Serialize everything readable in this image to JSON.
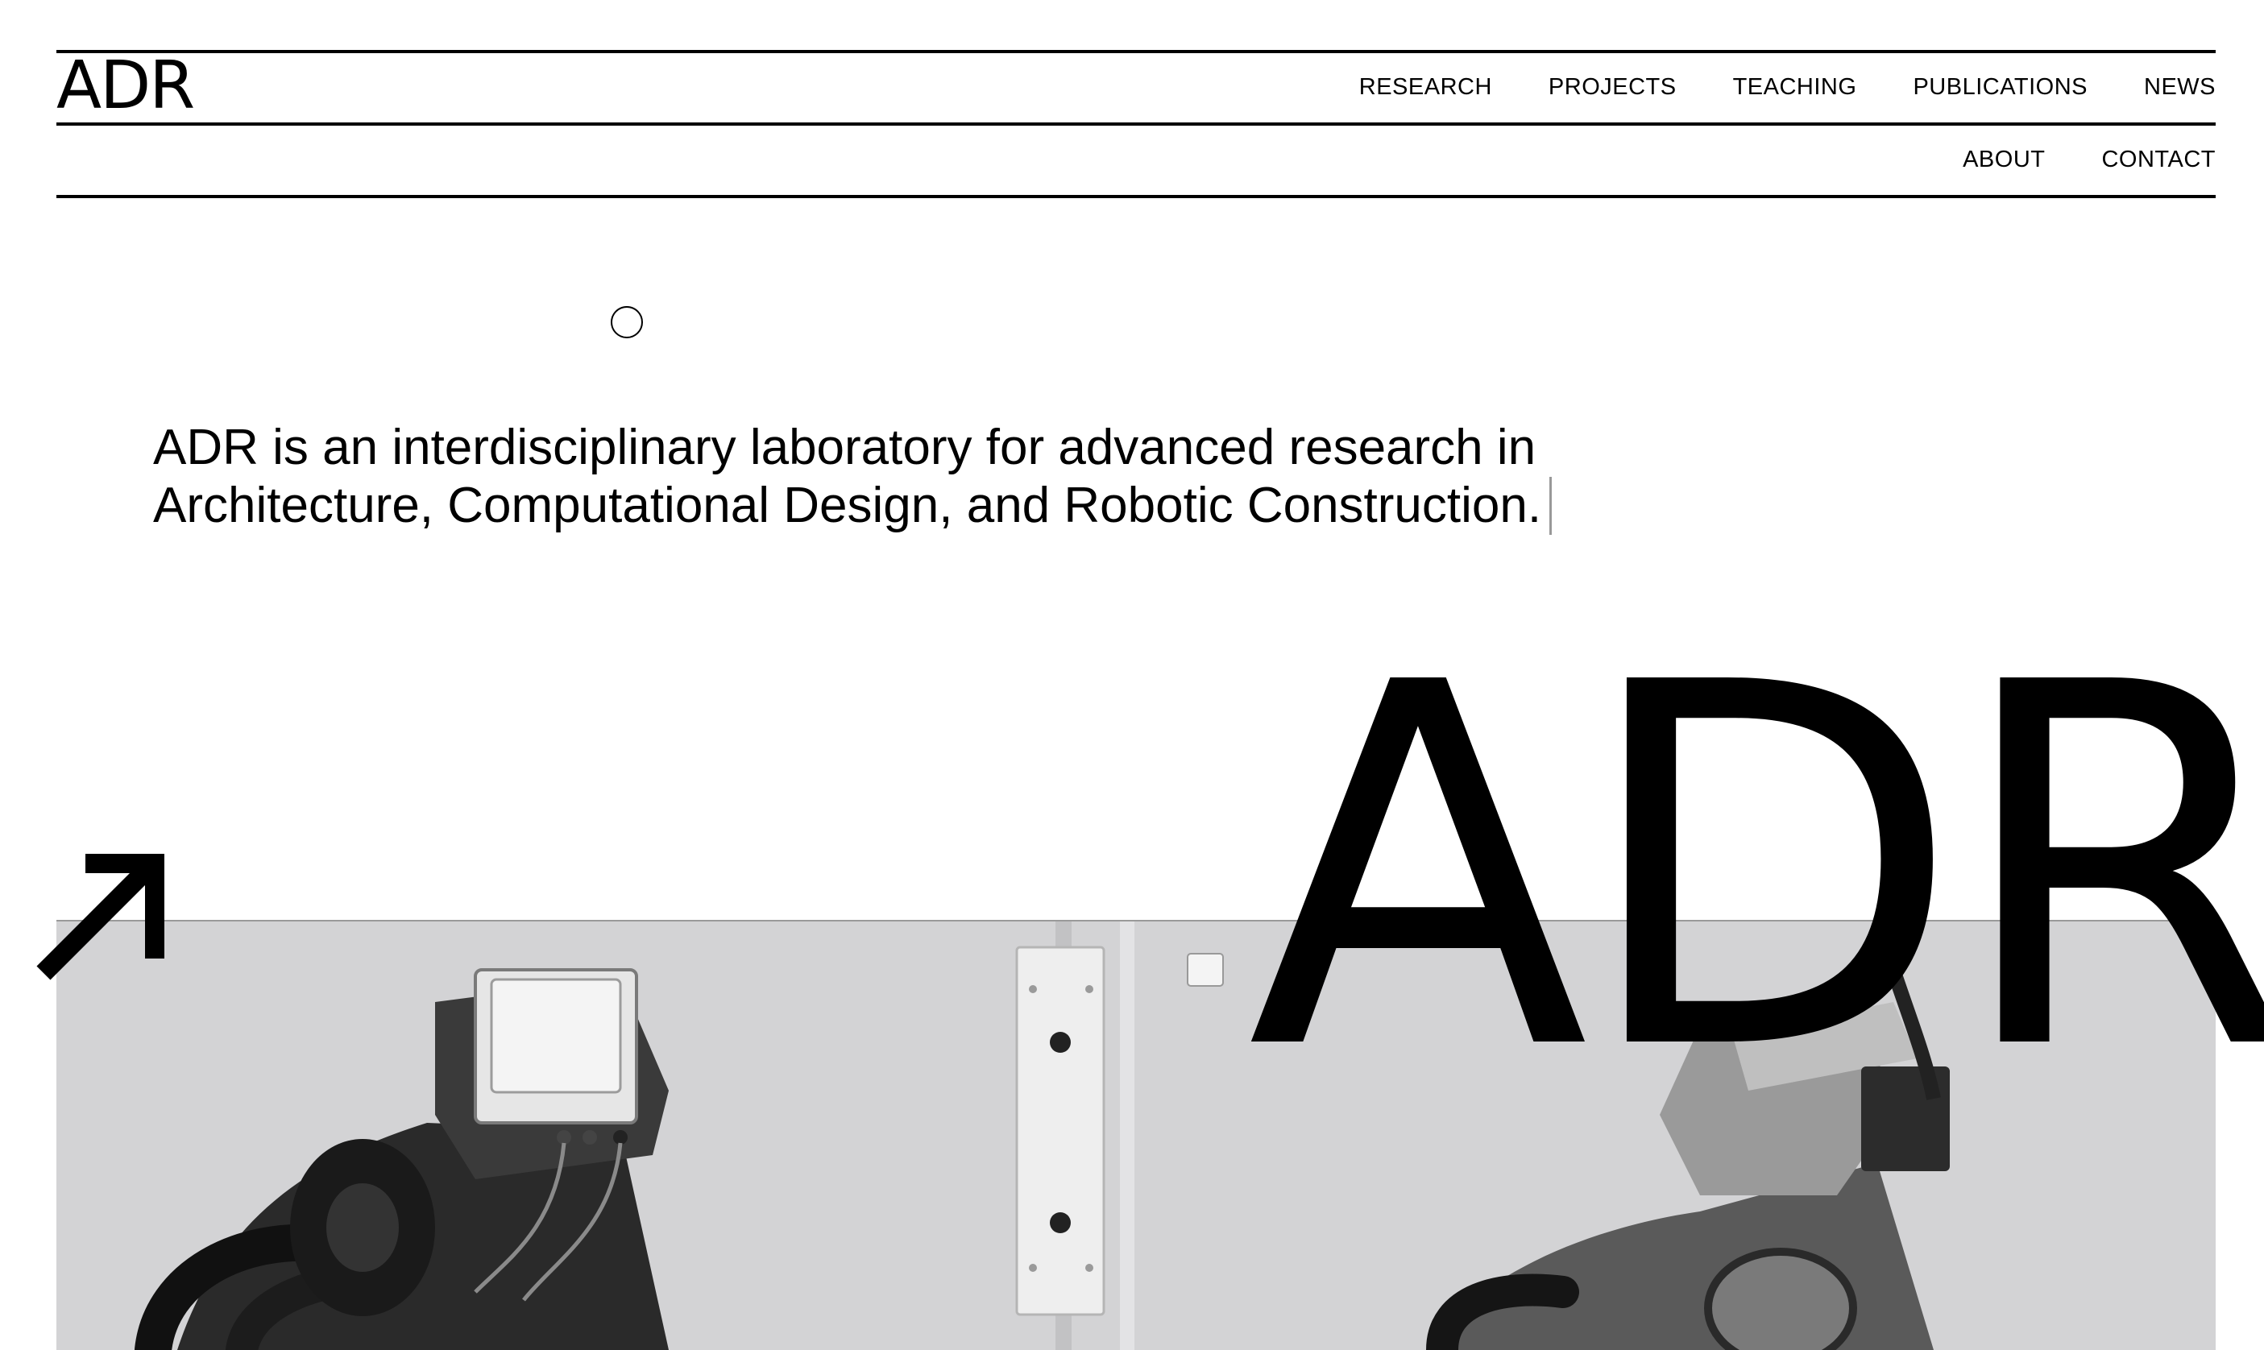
{
  "header": {
    "logo": "ADR",
    "nav_primary": [
      "RESEARCH",
      "PROJECTS",
      "TEACHING",
      "PUBLICATIONS",
      "NEWS"
    ],
    "nav_secondary": [
      "ABOUT",
      "CONTACT"
    ]
  },
  "intro": {
    "text": "ADR is an interdisciplinary laboratory for advanced research in Architecture, Computational Design, and Robotic Construction."
  },
  "hero": {
    "big_logo": "ADR",
    "arrow_icon": "arrow-up-right-icon",
    "image_subject": "robotic arms (grayscale)"
  },
  "colors": {
    "background": "#ffffff",
    "text": "#000000",
    "photo_gray": "#d2d2d4"
  }
}
